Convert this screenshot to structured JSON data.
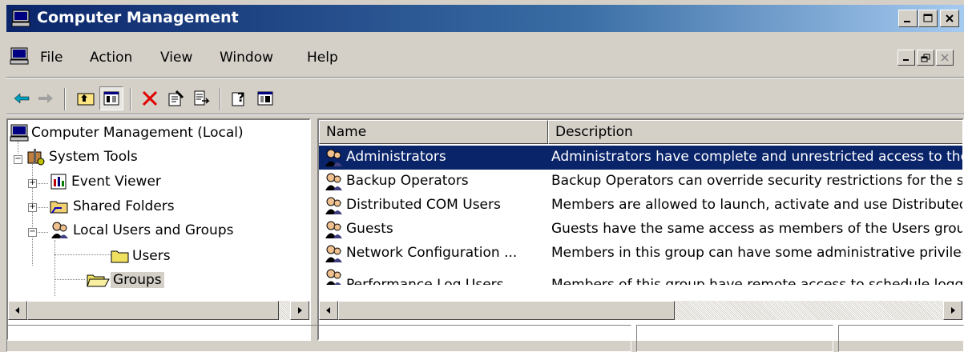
{
  "window": {
    "title": "Computer Management",
    "title_icon": "computer-management-icon",
    "controls": [
      "minimize-icon",
      "maximize-icon",
      "close-icon"
    ]
  },
  "menubar": {
    "items": [
      {
        "label": "File"
      },
      {
        "label": "Action"
      },
      {
        "label": "View"
      },
      {
        "label": "Window"
      },
      {
        "label": "Help"
      }
    ]
  },
  "toolbar": {
    "buttons": [
      "back-icon",
      "forward-icon",
      "up-one-level-icon",
      "show-hide-console-tree-icon",
      "delete-icon",
      "properties-icon",
      "export-list-icon",
      "help-icon",
      "show-hide-action-pane-icon"
    ]
  },
  "tree": {
    "items": [
      {
        "label": "Computer Management (Local)"
      },
      {
        "label": "System Tools"
      },
      {
        "label": "Event Viewer"
      },
      {
        "label": "Shared Folders"
      },
      {
        "label": "Local Users and Groups"
      },
      {
        "label": "Users"
      },
      {
        "label": "Groups"
      }
    ]
  },
  "list": {
    "columns": [
      {
        "label": "Name"
      },
      {
        "label": "Description"
      }
    ],
    "rows": [
      {
        "name": "Administrators",
        "description": "Administrators have complete and unrestricted access to the computer/domain"
      },
      {
        "name": "Backup Operators",
        "description": "Backup Operators can override security restrictions for the sole purpose of backing up or restoring files"
      },
      {
        "name": "Distributed COM Users",
        "description": "Members are allowed to launch, activate and use Distributed COM objects on this machine."
      },
      {
        "name": "Guests",
        "description": "Guests have the same access as members of the Users group by default"
      },
      {
        "name": "Network Configuration ...",
        "description": "Members in this group can have some administrative privileges"
      },
      {
        "name": "Performance Log Users",
        "description": "Members of this group have remote access to schedule logging"
      }
    ]
  },
  "colors": {
    "title_active": "#0a246a",
    "selection": "#0a246a",
    "face": "#d4d0c8"
  }
}
